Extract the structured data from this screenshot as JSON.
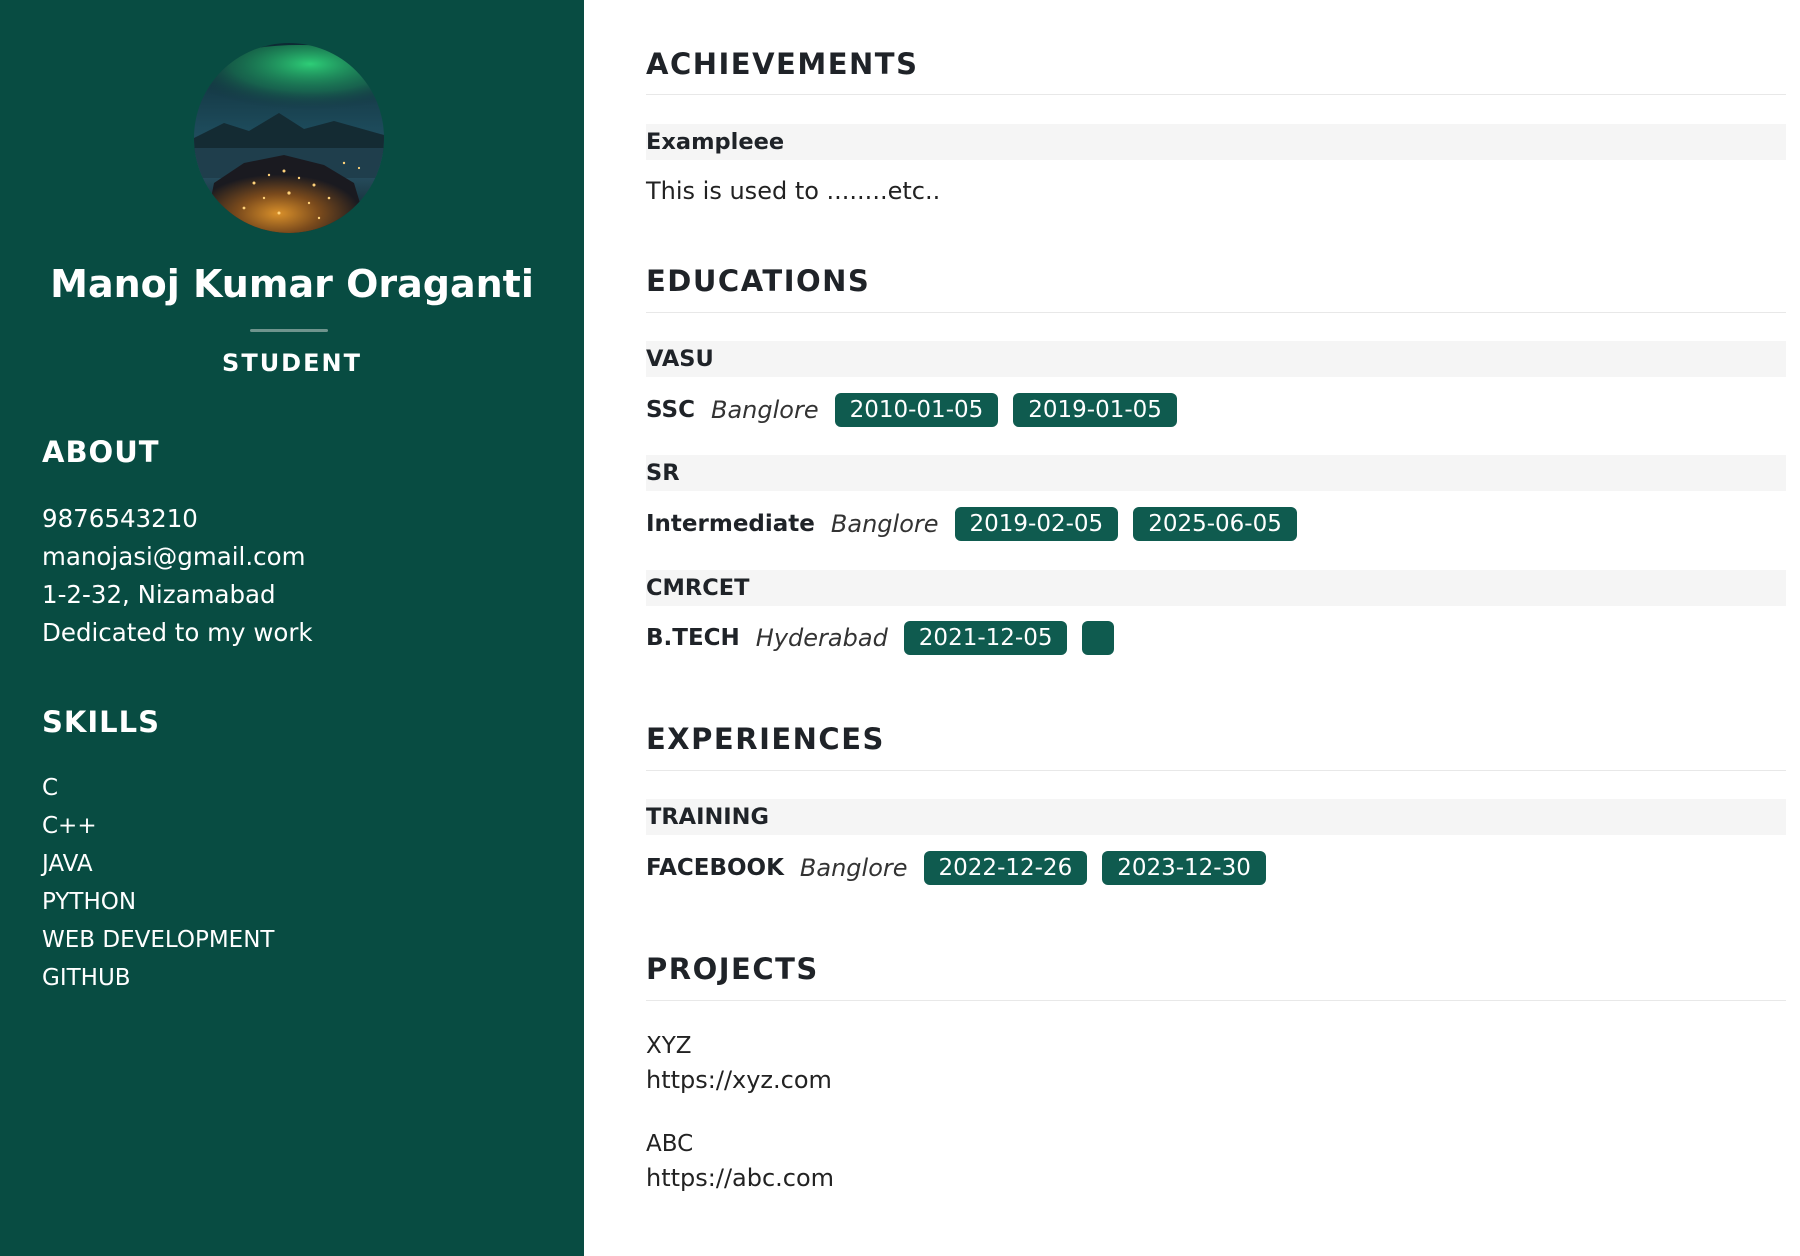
{
  "profile": {
    "name": "Manoj Kumar Oraganti",
    "role": "STUDENT"
  },
  "about": {
    "heading": "ABOUT",
    "items": [
      "9876543210",
      "manojasi@gmail.com",
      "1-2-32, Nizamabad",
      "Dedicated to my work"
    ]
  },
  "skills": {
    "heading": "SKILLS",
    "items": [
      "C",
      "C++",
      "JAVA",
      "PYTHON",
      "WEB DEVELOPMENT",
      "GITHUB"
    ]
  },
  "achievements": {
    "heading": "ACHIEVEMENTS",
    "items": [
      {
        "title": "Exampleee",
        "description": "This is used to ........etc.."
      }
    ]
  },
  "educations": {
    "heading": "EDUCATIONS",
    "items": [
      {
        "institution": "VASU",
        "degree": "SSC",
        "location": "Banglore",
        "start": "2010-01-05",
        "end": "2019-01-05"
      },
      {
        "institution": "SR",
        "degree": "Intermediate",
        "location": "Banglore",
        "start": "2019-02-05",
        "end": "2025-06-05"
      },
      {
        "institution": "CMRCET",
        "degree": "B.TECH",
        "location": "Hyderabad",
        "start": "2021-12-05",
        "end": ""
      }
    ]
  },
  "experiences": {
    "heading": "EXPERIENCES",
    "items": [
      {
        "title": "TRAINING",
        "company": "FACEBOOK",
        "location": "Banglore",
        "start": "2022-12-26",
        "end": "2023-12-30"
      }
    ]
  },
  "projects": {
    "heading": "PROJECTS",
    "items": [
      {
        "name": "XYZ",
        "link": "https://xyz.com"
      },
      {
        "name": "ABC",
        "link": "https://abc.com"
      }
    ]
  },
  "colors": {
    "sidebar_bg": "#084c42",
    "pill_bg": "#0f5b4f",
    "band_bg": "#f5f5f5"
  }
}
